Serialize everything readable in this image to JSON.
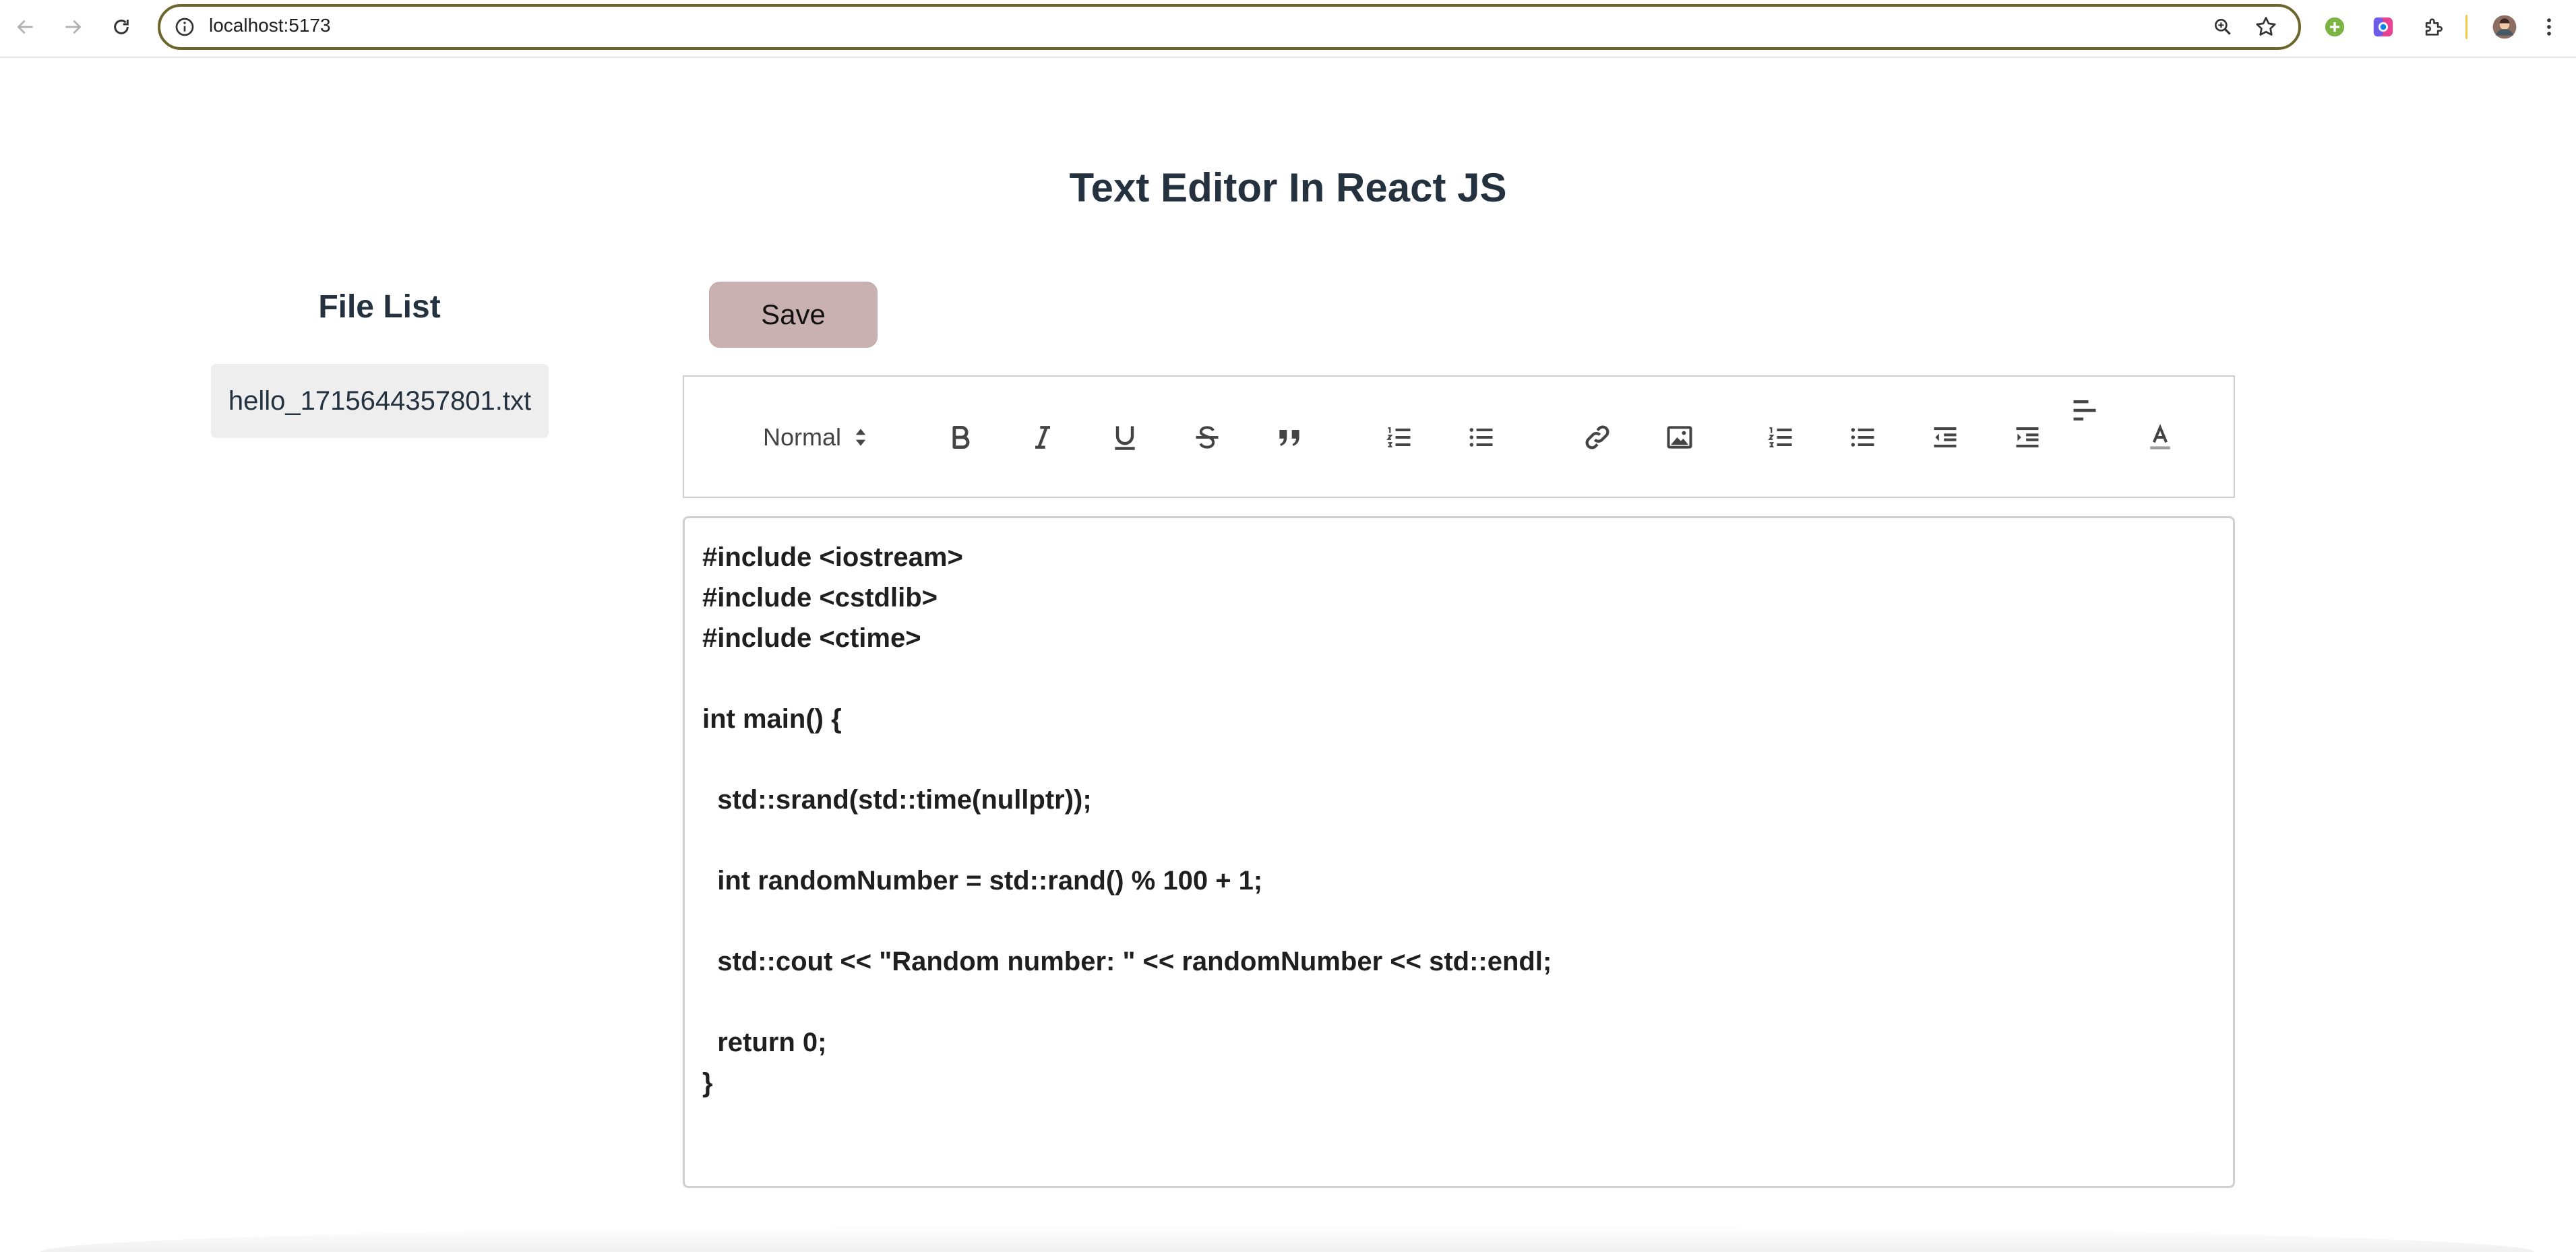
{
  "browser": {
    "url": "localhost:5173",
    "colors": {
      "omnibox_border": "#6b6629"
    }
  },
  "page": {
    "title": "Text Editor In React JS"
  },
  "file_list": {
    "title": "File List",
    "items": [
      {
        "name": "hello_1715644357801.txt"
      }
    ]
  },
  "editor": {
    "save_label": "Save",
    "toolbar": {
      "header_select": "Normal",
      "buttons": [
        "bold-icon",
        "italic-icon",
        "underline-icon",
        "strikethrough-icon",
        "blockquote-icon",
        "ordered-list-icon",
        "bullet-list-icon",
        "link-icon",
        "image-icon",
        "ordered-list-icon",
        "bullet-list-icon",
        "outdent-icon",
        "indent-icon",
        "align-left-icon",
        "text-color-icon"
      ]
    },
    "content": {
      "lines": [
        "#include <iostream>",
        "#include <cstdlib>",
        "#include <ctime>",
        "",
        "int main() {",
        "",
        "  std::srand(std::time(nullptr));",
        "",
        "  int randomNumber = std::rand() % 100 + 1;",
        "",
        "  std::cout << \"Random number: \" << randomNumber << std::endl;",
        "",
        "  return 0;",
        "}"
      ]
    }
  },
  "colors": {
    "heading": "#24313f",
    "save_button": "#c9b1b1",
    "file_item_bg": "#eeeeee"
  }
}
